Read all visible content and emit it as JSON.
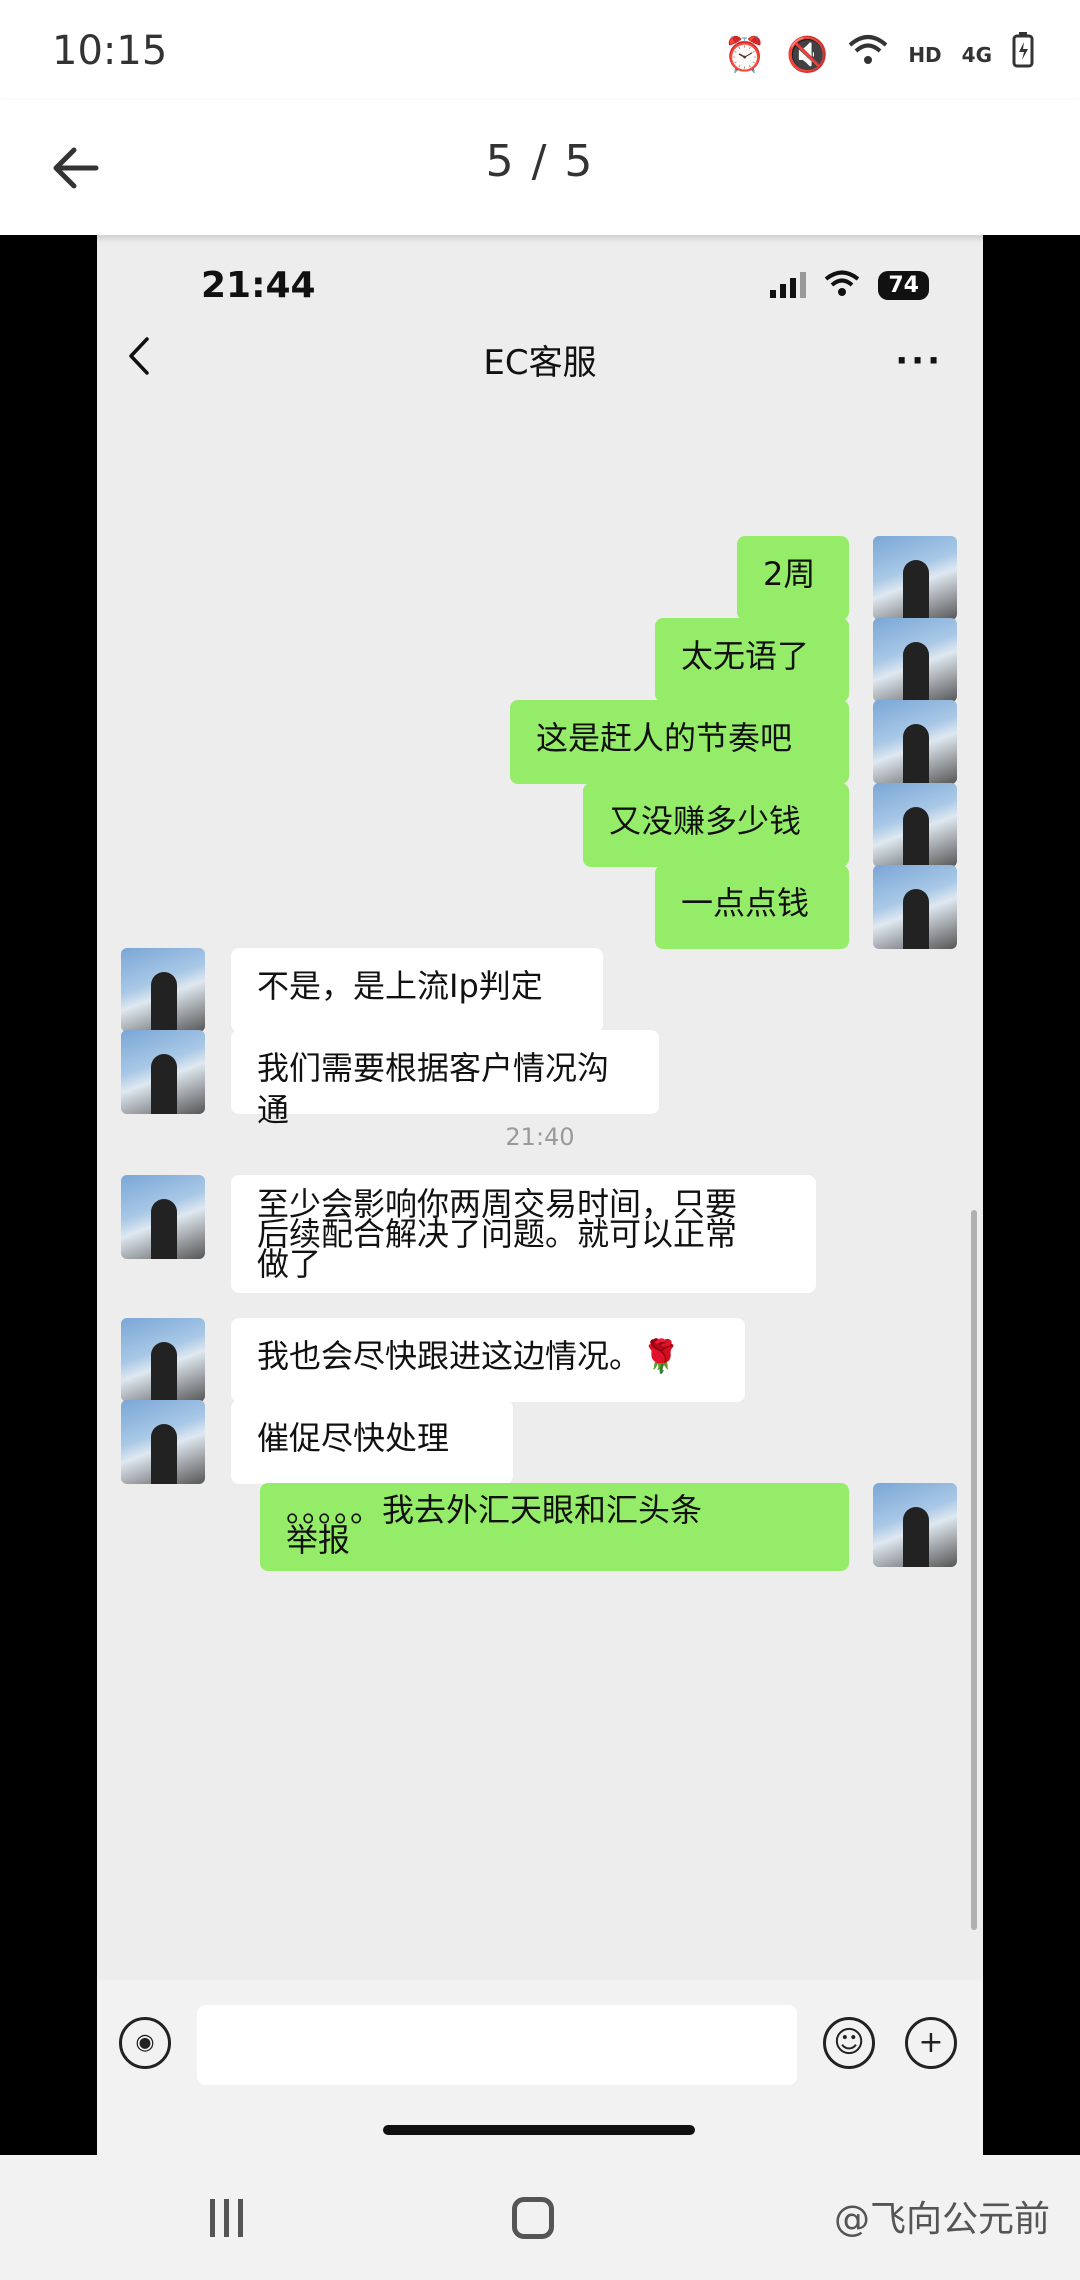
{
  "os_status": {
    "time": "10:15",
    "network_label": "HD",
    "network_type": "4G"
  },
  "viewer": {
    "counter": "5 / 5"
  },
  "inner_status": {
    "time": "21:44",
    "battery": "74"
  },
  "chat": {
    "title": "EC客服",
    "more": "···",
    "messages": [
      {
        "text": "2周"
      },
      {
        "text": "太无语了"
      },
      {
        "text": "这是赶人的节奏吧"
      },
      {
        "text": "又没赚多少钱"
      },
      {
        "text": "一点点钱"
      },
      {
        "text": "不是，是上流Ip判定"
      },
      {
        "text": "我们需要根据客户情况沟通"
      },
      {
        "text": "至少会影响你两周交易时间，只要\n后续配合解决了问题。就可以正常\n做了"
      },
      {
        "text": "我也会尽快跟进这边情况。🌹"
      },
      {
        "text": "催促尽快处理"
      },
      {
        "text": "。。。。。我去外汇天眼和汇头条\n举报"
      }
    ],
    "timestamp": "21:40"
  },
  "watermark": "飞向公元前",
  "colors": {
    "sent_bubble": "#95ec69",
    "received_bubble": "#ffffff",
    "chat_bg": "#ededed"
  }
}
